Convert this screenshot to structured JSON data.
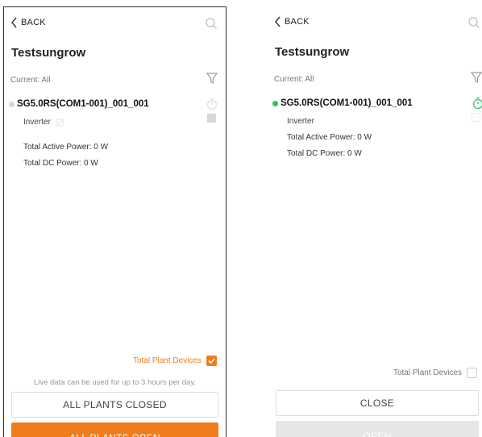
{
  "colors": {
    "accent_orange": "#f07d1c",
    "online_green": "#2ec26b",
    "offline_gray": "#d8d8d8",
    "disabled_button": "#e6e6e6"
  },
  "left_screen": {
    "back_label": "BACK",
    "plant_name": "Testsungrow",
    "filter_label": "Current: All",
    "device": {
      "status": "offline",
      "model": "SG5.0RS",
      "suffix": "(COM1-001)_001_001",
      "type": "Inverter",
      "active_power": "Total Active Power: 0 W",
      "dc_power": "Total DC Power: 0 W"
    },
    "total_plant_devices_label": "Total Plant Devices",
    "total_plant_devices_checked": true,
    "note": "Live data can be used for up to 3 hours per day.",
    "secondary_button": "ALL PLANTS CLOSED",
    "primary_button": "ALL PLANTS OPEN"
  },
  "right_screen": {
    "back_label": "BACK",
    "plant_name": "Testsungrow",
    "filter_label": "Current: All",
    "device": {
      "status": "online",
      "model": "SG5.0RS",
      "suffix": "(COM1-001)_001_001",
      "type": "Inverter",
      "active_power": "Total Active Power: 0 W",
      "dc_power": "Total DC Power: 0 W"
    },
    "total_plant_devices_label": "Total Plant Devices",
    "total_plant_devices_checked": false,
    "secondary_button": "CLOSE",
    "primary_button": "OPEN"
  },
  "icons": {
    "back": "chevron-left-icon",
    "search": "search-icon",
    "filter": "filter-funnel-icon",
    "timer": "stopwatch-icon",
    "inverter": "inverter-icon",
    "checkbox": "checkbox-icon"
  }
}
